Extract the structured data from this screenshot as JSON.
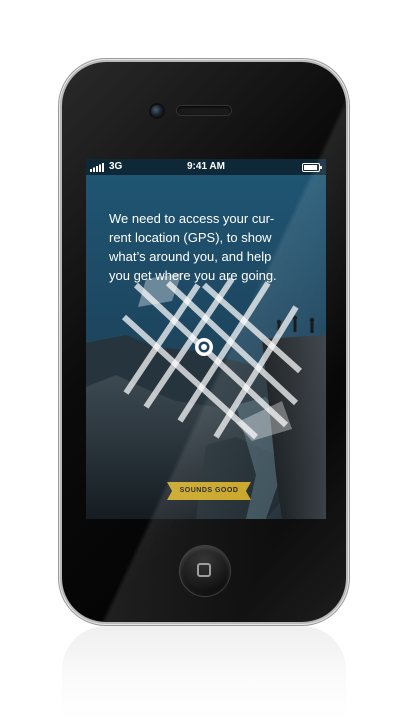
{
  "status_bar": {
    "network": "3G",
    "time": "9:41 AM",
    "battery_level": 0.9
  },
  "permission_screen": {
    "message": "We need to access your cur-\nrent location (GPS), to show\nwhat’s around you, and help\nyou get where you are going.",
    "button_label": "SOUNDS GOOD"
  },
  "colors": {
    "accent": "#c9a524",
    "sky": "#1d4660",
    "status_bar": "#0e2838"
  },
  "icons": [
    "signal-icon",
    "battery-icon",
    "location-pin-icon",
    "camera-icon",
    "speaker-icon",
    "home-button-icon"
  ]
}
